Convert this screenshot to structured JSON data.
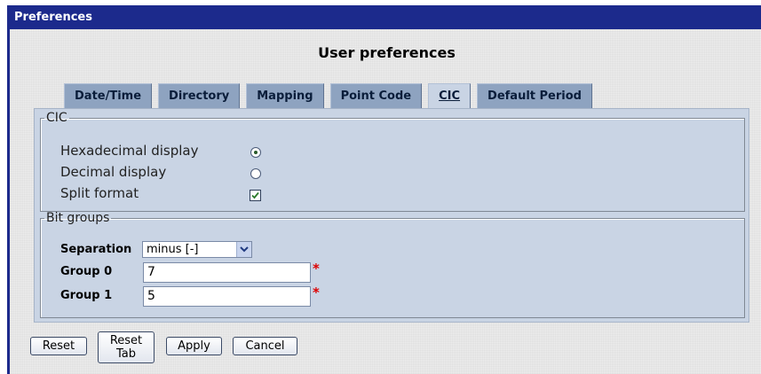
{
  "window": {
    "title": "Preferences"
  },
  "page": {
    "heading": "User preferences"
  },
  "tabs": [
    {
      "label": "Date/Time",
      "active": false
    },
    {
      "label": "Directory",
      "active": false
    },
    {
      "label": "Mapping",
      "active": false
    },
    {
      "label": "Point Code",
      "active": false
    },
    {
      "label": "CIC",
      "active": true
    },
    {
      "label": "Default Period",
      "active": false
    }
  ],
  "cic": {
    "legend": "CIC",
    "options": [
      {
        "label": "Hexadecimal display",
        "type": "radio",
        "checked": true
      },
      {
        "label": "Decimal display",
        "type": "radio",
        "checked": false
      },
      {
        "label": "Split format",
        "type": "checkbox",
        "checked": true
      }
    ]
  },
  "bit_groups": {
    "legend": "Bit groups",
    "separation_label": "Separation",
    "separation_value": "minus [-]",
    "group0_label": "Group 0",
    "group0_value": "7",
    "group1_label": "Group 1",
    "group1_value": "5",
    "required_marker": "*"
  },
  "buttons": {
    "reset": "Reset",
    "reset_tab": "Reset Tab",
    "apply": "Apply",
    "cancel": "Cancel"
  },
  "colors": {
    "title_bar": "#1c2a8c",
    "tab": "#8ea3c0",
    "panel": "#c9d4e4",
    "required": "#dd0000"
  }
}
